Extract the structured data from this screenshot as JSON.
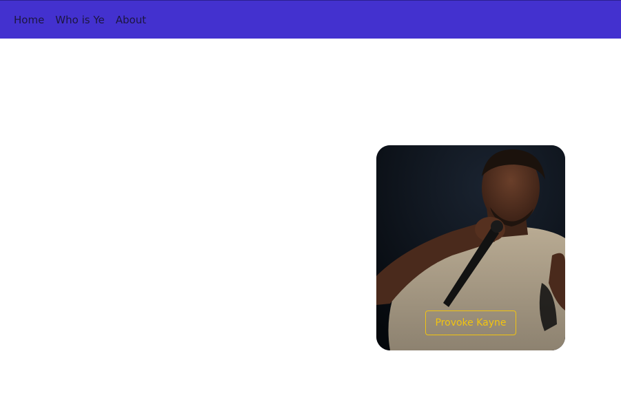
{
  "nav": {
    "links": [
      {
        "label": "Home"
      },
      {
        "label": "Who is Ye"
      },
      {
        "label": "About"
      }
    ]
  },
  "hero": {
    "button_label": "Provoke Kayne"
  },
  "colors": {
    "navbar_bg": "#4331cf",
    "nav_text": "#1c1640",
    "button_accent": "#f2c410",
    "page_bg": "#ffffff"
  }
}
